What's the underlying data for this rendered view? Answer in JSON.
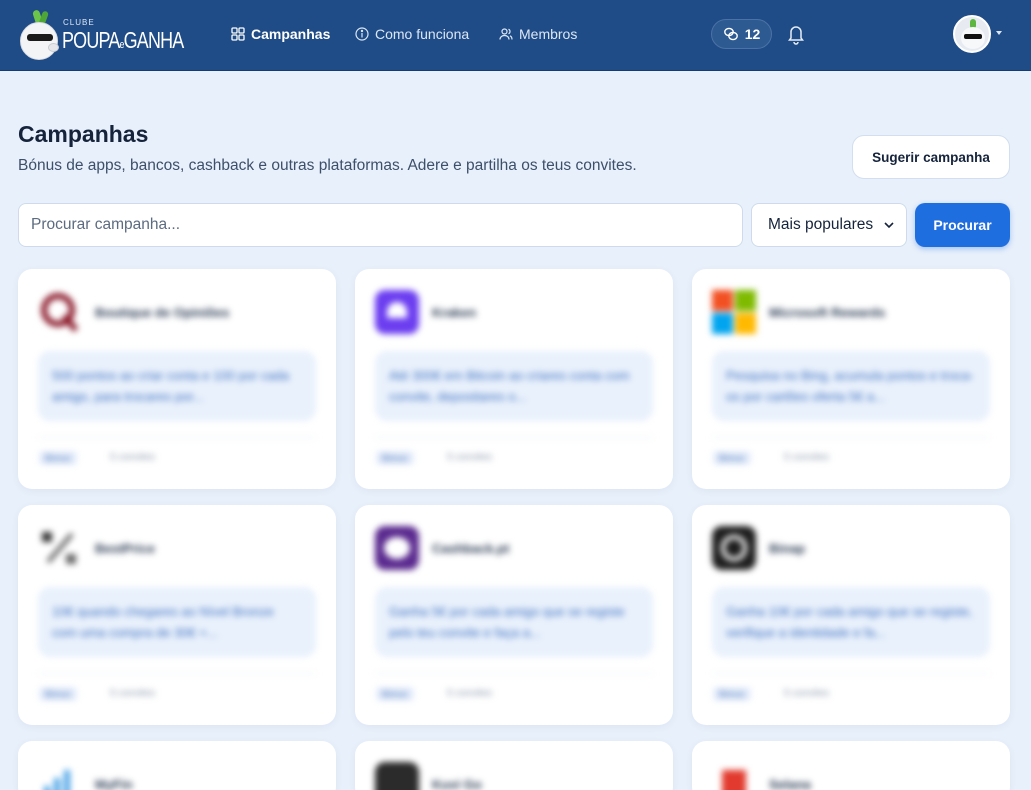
{
  "brand": {
    "small": "CLUBE",
    "name_part1": "POUPA",
    "name_e": "e",
    "name_part2": "GANHA"
  },
  "nav": [
    {
      "label": "Campanhas",
      "icon": "grid-icon"
    },
    {
      "label": "Como funciona",
      "icon": "info-icon"
    },
    {
      "label": "Membros",
      "icon": "users-icon"
    }
  ],
  "header": {
    "coins": "12",
    "coin_icon": "coins-icon",
    "bell_icon": "bell-icon"
  },
  "page": {
    "title": "Campanhas",
    "subtitle": "Bónus de apps, bancos, cashback e outras plataformas. Adere e partilha os teus convites.",
    "suggest_label": "Sugerir campanha"
  },
  "search": {
    "placeholder": "Procurar campanha...",
    "sort_selected": "Mais populares",
    "button_label": "Procurar"
  },
  "colors": {
    "header": "#1f4c86",
    "accent": "#1f6ee0",
    "background": "#e8f0fb"
  },
  "campaigns": [
    {
      "name": "Boutique de Opiniões",
      "desc": "500 pontos ao criar conta e 100 por cada amigo, para trocares por...",
      "tag": "Bónus",
      "meta": "5 convites"
    },
    {
      "name": "Kraken",
      "desc": "Até 300€ em Bitcoin ao criares conta com convite, depositares o...",
      "tag": "Bónus",
      "meta": "5 convites"
    },
    {
      "name": "Microsoft Rewards",
      "desc": "Pesquisa no Bing, acumula pontos e troca-os por cartões oferta 5€ a...",
      "tag": "Bónus",
      "meta": "5 convites"
    },
    {
      "name": "BestPrice",
      "desc": "10€ quando chegares ao Nível Bronze com uma compra de 30€ +...",
      "tag": "Bónus",
      "meta": "5 convites"
    },
    {
      "name": "Cashback.pt",
      "desc": "Ganha 5€ por cada amigo que se registe pelo teu convite e faça a...",
      "tag": "Bónus",
      "meta": "5 convites"
    },
    {
      "name": "Binap",
      "desc": "Ganha 10€ por cada amigo que se registe, verifique a identidade e fa...",
      "tag": "Bónus",
      "meta": "5 convites"
    },
    {
      "name": "MyFin",
      "desc": "",
      "tag": "",
      "meta": ""
    },
    {
      "name": "Kuvi Go",
      "desc": "",
      "tag": "",
      "meta": ""
    },
    {
      "name": "Selana",
      "desc": "",
      "tag": "",
      "meta": ""
    }
  ]
}
